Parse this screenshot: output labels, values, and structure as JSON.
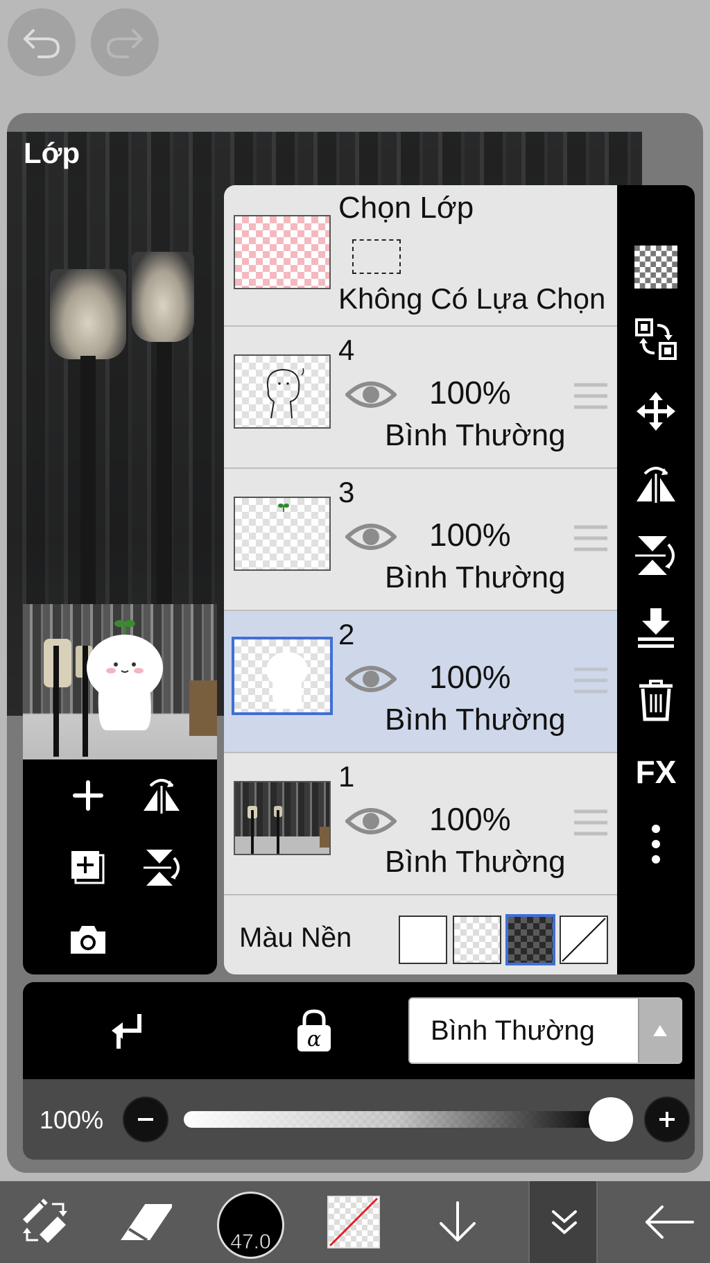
{
  "app": {
    "panel_title": "Lớp"
  },
  "layer_selection": {
    "title": "Chọn Lớp",
    "status": "Không Có Lựa Chọn"
  },
  "layers": [
    {
      "number": "4",
      "opacity": "100%",
      "blend_mode": "Bình Thường",
      "selected": false
    },
    {
      "number": "3",
      "opacity": "100%",
      "blend_mode": "Bình Thường",
      "selected": false
    },
    {
      "number": "2",
      "opacity": "100%",
      "blend_mode": "Bình Thường",
      "selected": true
    },
    {
      "number": "1",
      "opacity": "100%",
      "blend_mode": "Bình Thường",
      "selected": false
    }
  ],
  "background_color": {
    "label": "Màu Nền",
    "options": [
      "white",
      "transparent",
      "dark-checker",
      "none"
    ],
    "selected": "dark-checker"
  },
  "right_toolbar": {
    "fx_label": "FX",
    "icons": [
      "checker-icon",
      "transform-layer-icon",
      "move-icon",
      "flip-horizontal-icon",
      "flip-vertical-icon",
      "merge-down-icon",
      "trash-icon",
      "fx-icon",
      "more-icon"
    ]
  },
  "blend": {
    "mode_label": "Bình Thường"
  },
  "opacity": {
    "value_label": "100%",
    "value": 1.0
  },
  "brush": {
    "size_label": "47.0"
  },
  "colors": {
    "accent": "#3f6fd6",
    "selected_row": "#cfd8ea",
    "panel": "#797979",
    "list_bg": "#e6e6e6"
  }
}
